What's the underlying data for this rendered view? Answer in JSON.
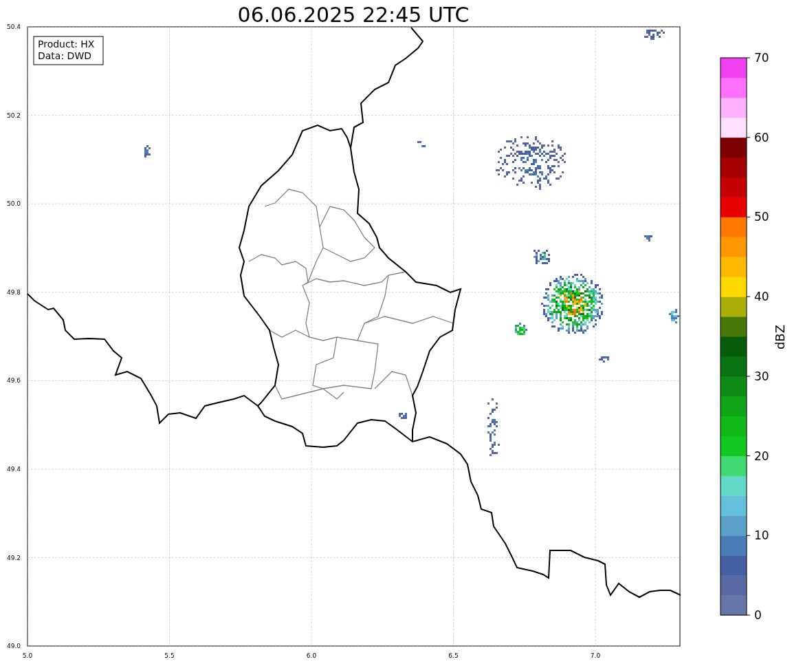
{
  "title": "06.06.2025 22:45 UTC",
  "info_box": [
    "Product: HX",
    "Data: DWD"
  ],
  "x_ticks": [
    "5.0",
    "5.5",
    "6.0",
    "6.5",
    "7.0"
  ],
  "y_ticks": [
    "50.4",
    "50.2",
    "50.0",
    "49.8",
    "49.6",
    "49.4",
    "49.2",
    "49.0"
  ],
  "colorbar": {
    "label": "dBZ",
    "ticks": [
      "70",
      "60",
      "50",
      "40",
      "30",
      "20",
      "10",
      "0"
    ],
    "bands": [
      {
        "color": "#6676a8"
      },
      {
        "color": "#5868a2"
      },
      {
        "color": "#4660a4"
      },
      {
        "color": "#4a7cb6"
      },
      {
        "color": "#5aa0c8"
      },
      {
        "color": "#64c0dc"
      },
      {
        "color": "#62d8c6"
      },
      {
        "color": "#40d870"
      },
      {
        "color": "#12c820"
      },
      {
        "color": "#10b818"
      },
      {
        "color": "#10a418"
      },
      {
        "color": "#0e8a16"
      },
      {
        "color": "#0a7414"
      },
      {
        "color": "#065c08"
      },
      {
        "color": "#487808"
      },
      {
        "color": "#aab008"
      },
      {
        "color": "#ffd800"
      },
      {
        "color": "#ffb800"
      },
      {
        "color": "#ff9800"
      },
      {
        "color": "#ff7800"
      },
      {
        "color": "#e80000"
      },
      {
        "color": "#c40000"
      },
      {
        "color": "#a40000"
      },
      {
        "color": "#7c0000"
      },
      {
        "color": "#ffe0ff"
      },
      {
        "color": "#ffb0ff"
      },
      {
        "color": "#ff70ff"
      },
      {
        "color": "#f040f0"
      }
    ]
  }
}
